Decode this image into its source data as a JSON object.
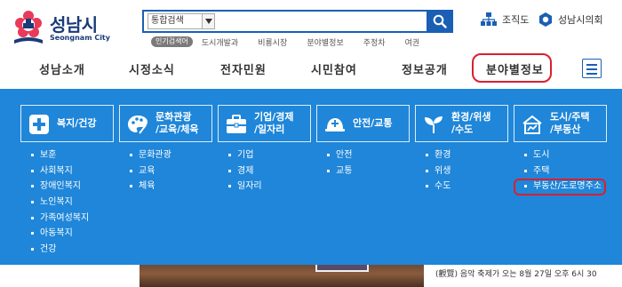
{
  "header": {
    "logo": {
      "ko": "성남시",
      "en": "Seongnam City"
    },
    "search": {
      "select_value": "통합검색"
    },
    "popular": {
      "badge": "인기검색어",
      "items": [
        "도시개발과",
        "비룡시장",
        "분야별정보",
        "주정차",
        "여권"
      ]
    },
    "quick_links": [
      {
        "label": "조직도",
        "icon": "org-chart-icon"
      },
      {
        "label": "성남시의회",
        "icon": "council-icon"
      }
    ]
  },
  "gnb": {
    "items": [
      "성남소개",
      "시정소식",
      "전자민원",
      "시민참여",
      "정보공개",
      "분야별정보"
    ],
    "active": "분야별정보"
  },
  "mega": {
    "categories": [
      {
        "label": [
          "복지/건강"
        ],
        "icon": "plus-cross-icon",
        "items": [
          "보훈",
          "사회복지",
          "장애인복지",
          "노인복지",
          "가족여성복지",
          "아동복지",
          "건강"
        ]
      },
      {
        "label": [
          "문화관광",
          "/교육/체육"
        ],
        "icon": "palette-icon",
        "items": [
          "문화관광",
          "교육",
          "체육"
        ]
      },
      {
        "label": [
          "기업/경제",
          "/일자리"
        ],
        "icon": "briefcase-icon",
        "items": [
          "기업",
          "경제",
          "일자리"
        ]
      },
      {
        "label": [
          "안전/교통"
        ],
        "icon": "helmet-icon",
        "items": [
          "안전",
          "교통"
        ]
      },
      {
        "label": [
          "환경/위생",
          "/수도"
        ],
        "icon": "leaf-sprout-icon",
        "items": [
          "환경",
          "위생",
          "수도"
        ]
      },
      {
        "label": [
          "도시/주택",
          "/부동산"
        ],
        "icon": "house-chart-icon",
        "items": [
          "도시",
          "주택",
          "부동산/도로명주소"
        ]
      }
    ],
    "highlighted_item": "부동산/도로명주소"
  },
  "bottom": {
    "notice": "(觀覽) 음악 축제가 오는 8월 27일 오후 6시 30"
  },
  "colors": {
    "brand_blue": "#1a5fb4",
    "mega_bg": "#1f86d9",
    "highlight_red": "#d8202e"
  }
}
